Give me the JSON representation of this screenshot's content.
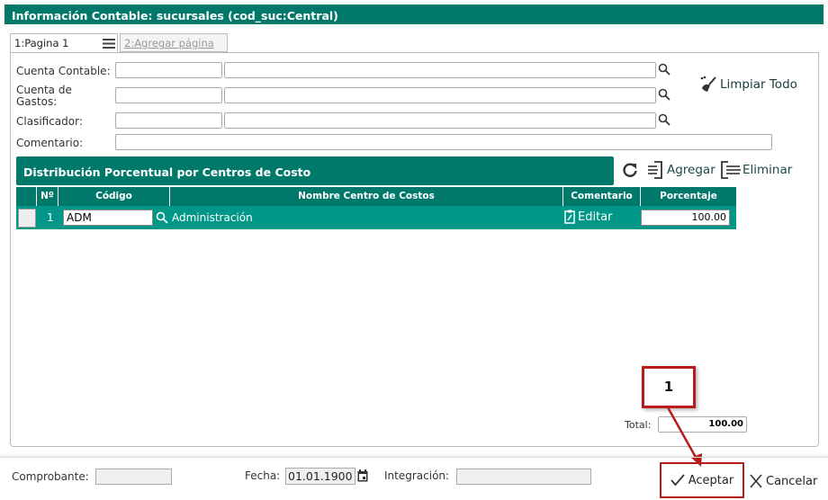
{
  "window": {
    "title": "Información Contable: sucursales (cod_suc:Central)"
  },
  "tabs": [
    {
      "label": "1:Pagina 1",
      "active": true
    },
    {
      "label": "2:Agregar página",
      "active": false
    }
  ],
  "form": {
    "cuenta_contable": {
      "label": "Cuenta Contable:",
      "code": "",
      "name": ""
    },
    "cuenta_gastos": {
      "label": "Cuenta de Gastos:",
      "code": "",
      "name": ""
    },
    "clasificador": {
      "label": "Clasificador:",
      "code": "",
      "name": ""
    },
    "comentario": {
      "label": "Comentario:",
      "value": ""
    },
    "clear_all": "Limpiar Todo"
  },
  "distribution": {
    "title": "Distribución Porcentual por Centros de Costo",
    "add": "Agregar",
    "remove": "Eliminar",
    "columns": [
      "Nº",
      "Código",
      "Nombre Centro de Costos",
      "Comentario",
      "Porcentaje"
    ],
    "rows": [
      {
        "n": "1",
        "codigo": "ADM",
        "nombre": "Administración",
        "comentario": "Editar",
        "porcentaje": "100.00"
      }
    ],
    "total_label": "Total:",
    "total": "100.00"
  },
  "annotation": {
    "label": "1",
    "color": "#b71c1c"
  },
  "footer": {
    "comprobante_label": "Comprobante:",
    "comprobante": "",
    "fecha_label": "Fecha:",
    "fecha": "01.01.1900",
    "integracion_label": "Integración:",
    "integracion": "",
    "accept": "Aceptar",
    "cancel": "Cancelar"
  },
  "colors": {
    "header": "#00796b",
    "row": "#009688"
  }
}
